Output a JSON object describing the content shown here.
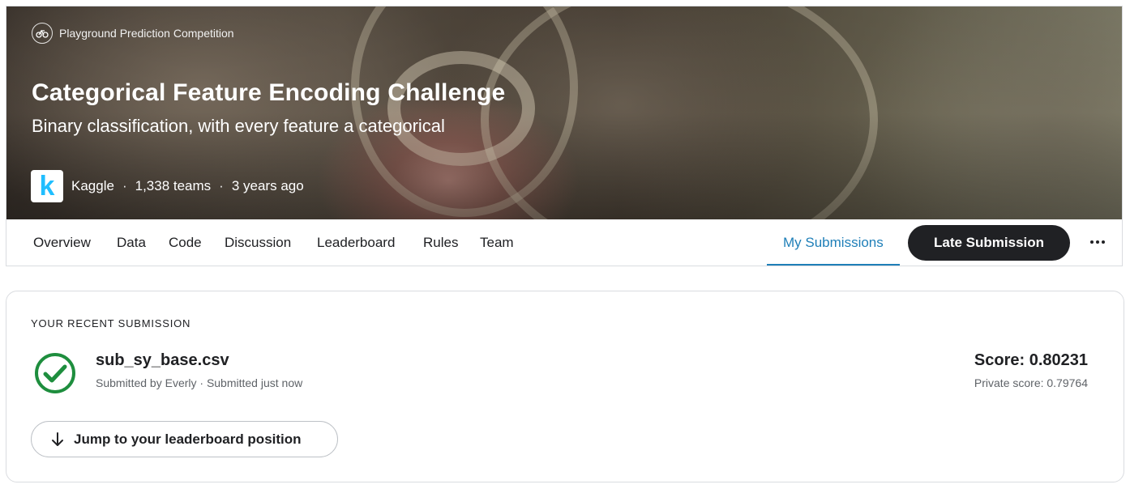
{
  "header": {
    "competition_type": "Playground Prediction Competition",
    "competition_type_icon": "cycling-icon",
    "title": "Categorical Feature Encoding Challenge",
    "subtitle": "Binary classification, with every feature a categorical",
    "host_logo_letter": "k",
    "host": "Kaggle",
    "separator": "·",
    "teams": "1,338 teams",
    "age": "3 years ago"
  },
  "tabs": {
    "items": [
      "Overview",
      "Data",
      "Code",
      "Discussion",
      "Leaderboard",
      "Rules",
      "Team"
    ],
    "active": "My Submissions",
    "late_submission": "Late Submission",
    "more_icon": "more-horizontal-icon"
  },
  "submission": {
    "heading": "YOUR RECENT SUBMISSION",
    "status_icon": "check-circle-icon",
    "filename": "sub_sy_base.csv",
    "byline": "Submitted by Everly · Submitted just now",
    "score": "Score: 0.80231",
    "private_score": "Private score: 0.79764",
    "jump_button": "Jump to your leaderboard position",
    "jump_icon": "arrow-down-icon"
  },
  "colors": {
    "accent": "#1f7fb8",
    "success": "#1e8e3e",
    "primary_button": "#202124",
    "kaggle_blue": "#20beff"
  }
}
